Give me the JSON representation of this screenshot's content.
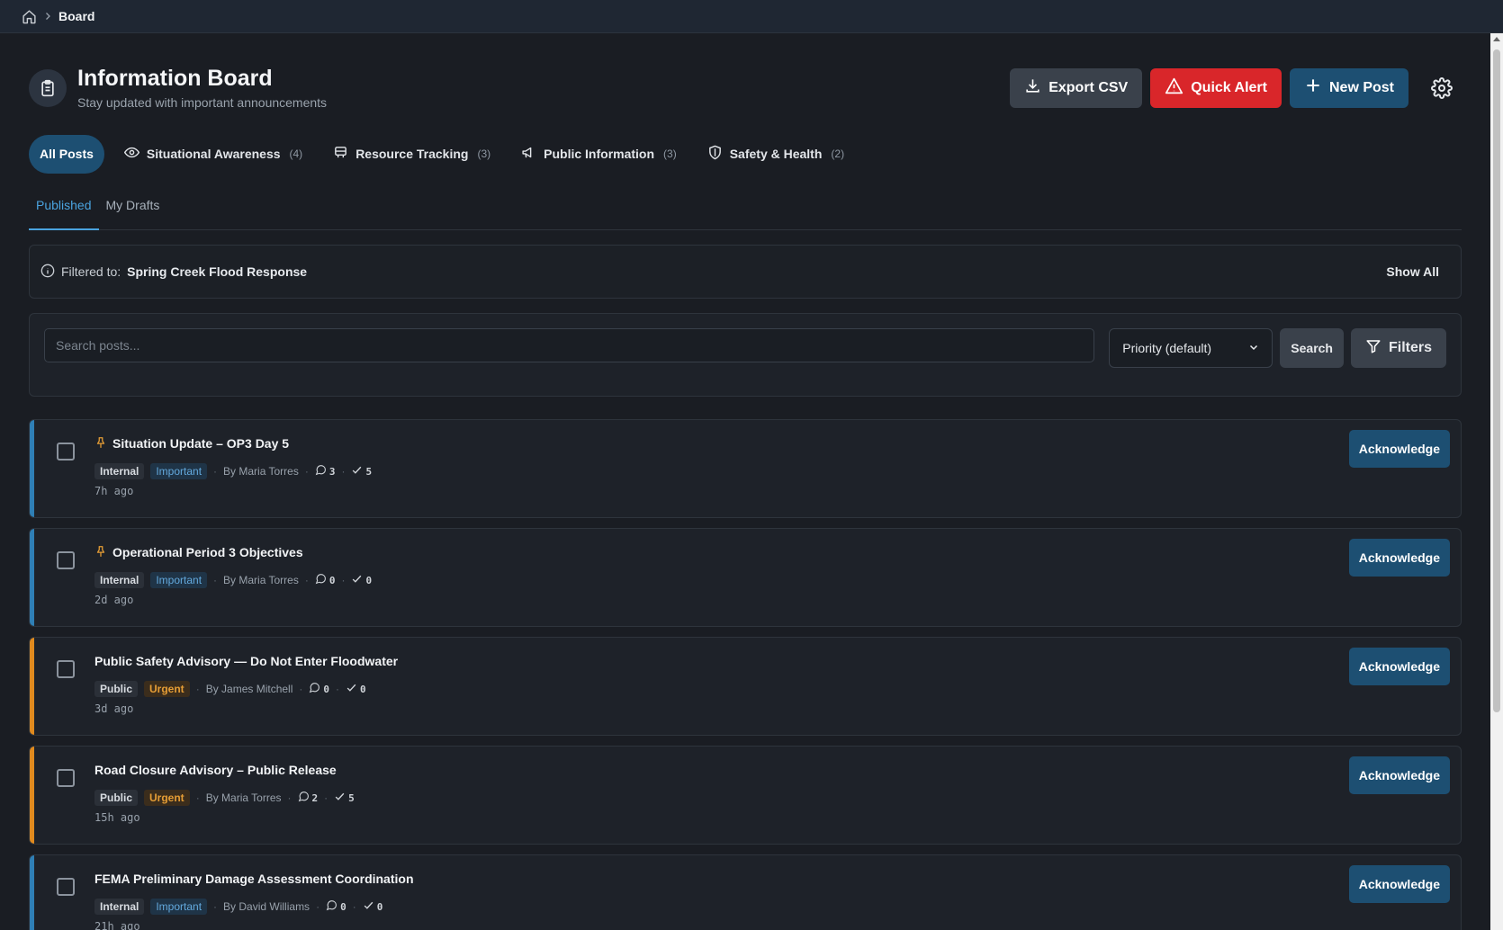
{
  "breadcrumb": {
    "home_icon": "home-icon",
    "current": "Board"
  },
  "header": {
    "title": "Information Board",
    "subtitle": "Stay updated with important announcements",
    "export_label": "Export CSV",
    "alert_label": "Quick Alert",
    "new_post_label": "New Post"
  },
  "categories": [
    {
      "label": "All Posts",
      "count": ""
    },
    {
      "label": "Situational Awareness",
      "count": "(4)"
    },
    {
      "label": "Resource Tracking",
      "count": "(3)"
    },
    {
      "label": "Public Information",
      "count": "(3)"
    },
    {
      "label": "Safety & Health",
      "count": "(2)"
    }
  ],
  "tabs": {
    "published": "Published",
    "drafts": "My Drafts"
  },
  "filter_notice": {
    "prefix": "Filtered to:",
    "value": "Spring Creek Flood Response",
    "show_all": "Show All"
  },
  "search": {
    "placeholder": "Search posts...",
    "sort_value": "Priority (default)",
    "search_label": "Search",
    "filters_label": "Filters"
  },
  "posts": [
    {
      "title": "Situation Update – OP3 Day 5",
      "pinned": true,
      "visibility": "Internal",
      "priority": "Important",
      "author": "By Maria Torres",
      "comments": "3",
      "acks": "5",
      "time": "7h ago",
      "action": "Acknowledge",
      "accent": "#2f7fb5"
    },
    {
      "title": "Operational Period 3 Objectives",
      "pinned": true,
      "visibility": "Internal",
      "priority": "Important",
      "author": "By Maria Torres",
      "comments": "0",
      "acks": "0",
      "time": "2d ago",
      "action": "Acknowledge",
      "accent": "#2f7fb5"
    },
    {
      "title": "Public Safety Advisory — Do Not Enter Floodwater",
      "pinned": false,
      "visibility": "Public",
      "priority": "Urgent",
      "author": "By James Mitchell",
      "comments": "0",
      "acks": "0",
      "time": "3d ago",
      "action": "Acknowledge",
      "accent": "#e08a1e"
    },
    {
      "title": "Road Closure Advisory – Public Release",
      "pinned": false,
      "visibility": "Public",
      "priority": "Urgent",
      "author": "By Maria Torres",
      "comments": "2",
      "acks": "5",
      "time": "15h ago",
      "action": "Acknowledge",
      "accent": "#e08a1e"
    },
    {
      "title": "FEMA Preliminary Damage Assessment Coordination",
      "pinned": false,
      "visibility": "Internal",
      "priority": "Important",
      "author": "By David Williams",
      "comments": "0",
      "acks": "0",
      "time": "21h ago",
      "action": "Acknowledge",
      "accent": "#2f7fb5"
    }
  ]
}
